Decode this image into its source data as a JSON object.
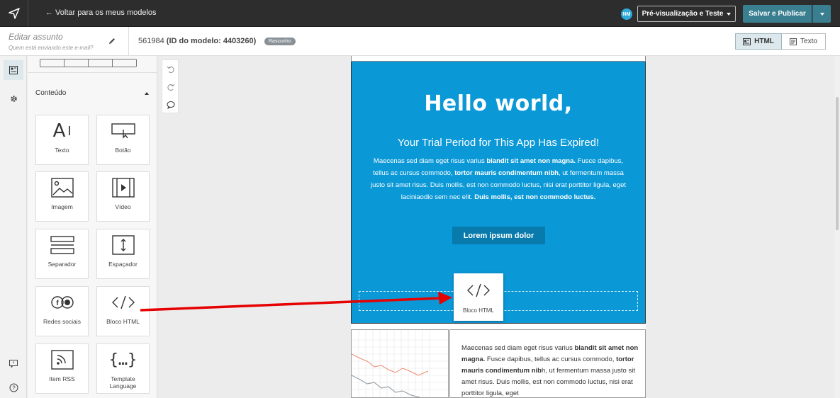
{
  "topbar": {
    "back_label": "← Voltar para os meus modelos",
    "avatar_initials": "NM",
    "preview_label": "Pré-visualização e Teste",
    "save_label": "Salvar e Publicar"
  },
  "subject": {
    "title_placeholder": "Editar assunto",
    "sender_placeholder": "Quem está enviando este e-mail?",
    "model_number": "561984",
    "model_id": "(ID do modelo: 4403260)",
    "status_badge": "Rascunho"
  },
  "view_tabs": {
    "html": "HTML",
    "text": "Texto"
  },
  "panel": {
    "section_title": "Conteúdo",
    "tiles": [
      {
        "label": "Texto",
        "icon": "text-icon"
      },
      {
        "label": "Botão",
        "icon": "button-icon"
      },
      {
        "label": "Imagem",
        "icon": "image-icon"
      },
      {
        "label": "Vídeo",
        "icon": "video-icon"
      },
      {
        "label": "Separador",
        "icon": "separator-icon"
      },
      {
        "label": "Espaçador",
        "icon": "spacer-icon"
      },
      {
        "label": "Redes sociais",
        "icon": "social-icon"
      },
      {
        "label": "Bloco HTML",
        "icon": "code-icon"
      },
      {
        "label": "Item RSS",
        "icon": "rss-icon"
      },
      {
        "label": "Template Language",
        "icon": "braces-icon"
      }
    ]
  },
  "email": {
    "title": "Hello world,",
    "subtitle": "Your Trial Period for This App Has Expired!",
    "body_1": "Maecenas sed diam eget risus varius ",
    "body_1_bold": "blandit sit amet non magna.",
    "body_2": " Fusce dapibus, tellus ac cursus commodo, ",
    "body_2_bold": "tortor mauris condimentum nibh",
    "body_3": ", ut fermentum massa justo sit amet risus. Duis mollis, est non commodo luctus, nisi erat porttitor ligula, eget laciniaodio sem nec elit. ",
    "body_3_bold": "Duis mollis, est non commodo luctus.",
    "button_label": "Lorem ipsum dolor",
    "drag_label": "Bloco HTML",
    "lower_text_1": "Maecenas sed diam eget risus varius ",
    "lower_text_1_bold": "blandit sit amet non magna.",
    "lower_text_2": " Fusce dapibus, tellus ac cursus commodo, ",
    "lower_text_2_bold": "tortor mauris condimentum nib",
    "lower_text_3": "h, ut fermentum massa justo sit amet risus. Duis mollis, est non commodo luctus, nisi erat porttitor ligula, eget"
  },
  "colors": {
    "hero_bg": "#0a98d7",
    "hero_button": "#087aab",
    "save_button": "#3a7f90",
    "arrow": "#e60000"
  }
}
